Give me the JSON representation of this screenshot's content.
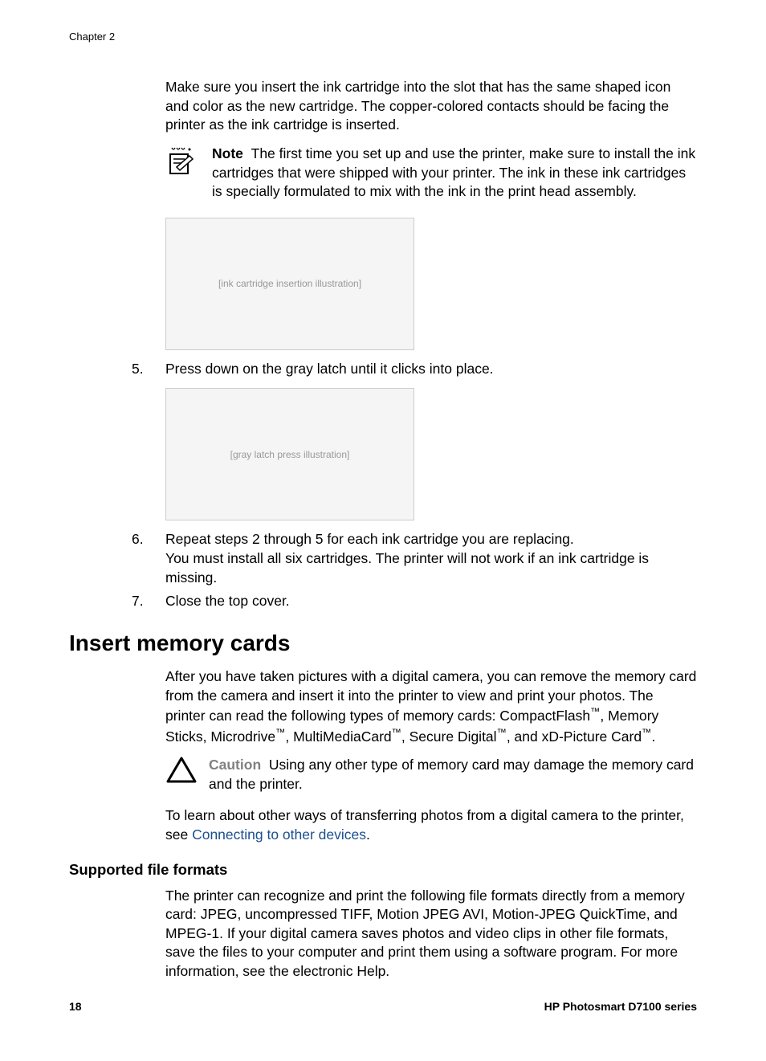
{
  "chapter_header": "Chapter 2",
  "intro": "Make sure you insert the ink cartridge into the slot that has the same shaped icon and color as the new cartridge. The copper-colored contacts should be facing the printer as the ink cartridge is inserted.",
  "note": {
    "label": "Note",
    "text": "The first time you set up and use the printer, make sure to install the ink cartridges that were shipped with your printer. The ink in these ink cartridges is specially formulated to mix with the ink in the print head assembly."
  },
  "figure1_alt": "[ink cartridge insertion illustration]",
  "step5": {
    "num": "5.",
    "text": "Press down on the gray latch until it clicks into place."
  },
  "figure2_alt": "[gray latch press illustration]",
  "step6": {
    "num": "6.",
    "line1": "Repeat steps 2 through 5 for each ink cartridge you are replacing.",
    "line2": "You must install all six cartridges. The printer will not work if an ink cartridge is missing."
  },
  "step7": {
    "num": "7.",
    "text": "Close the top cover."
  },
  "heading_memory": "Insert memory cards",
  "memory_intro_part1": "After you have taken pictures with a digital camera, you can remove the memory card from the camera and insert it into the printer to view and print your photos. The printer can read the following types of memory cards: CompactFlash",
  "memory_intro_part2": ", Memory Sticks, Microdrive",
  "memory_intro_part3": ", MultiMediaCard",
  "memory_intro_part4": ", Secure Digital",
  "memory_intro_part5": ", and xD-Picture Card",
  "memory_intro_part6": ".",
  "caution": {
    "label": "Caution",
    "text": "Using any other type of memory card may damage the memory card and the printer."
  },
  "transfer_pre": "To learn about other ways of transferring photos from a digital camera to the printer, see ",
  "transfer_link": "Connecting to other devices",
  "transfer_post": ".",
  "heading_formats": "Supported file formats",
  "formats_text": "The printer can recognize and print the following file formats directly from a memory card: JPEG, uncompressed TIFF, Motion JPEG AVI, Motion-JPEG QuickTime, and MPEG-1. If your digital camera saves photos and video clips in other file formats, save the files to your computer and print them using a software program. For more information, see the electronic Help.",
  "footer": {
    "page": "18",
    "product": "HP Photosmart D7100 series"
  }
}
